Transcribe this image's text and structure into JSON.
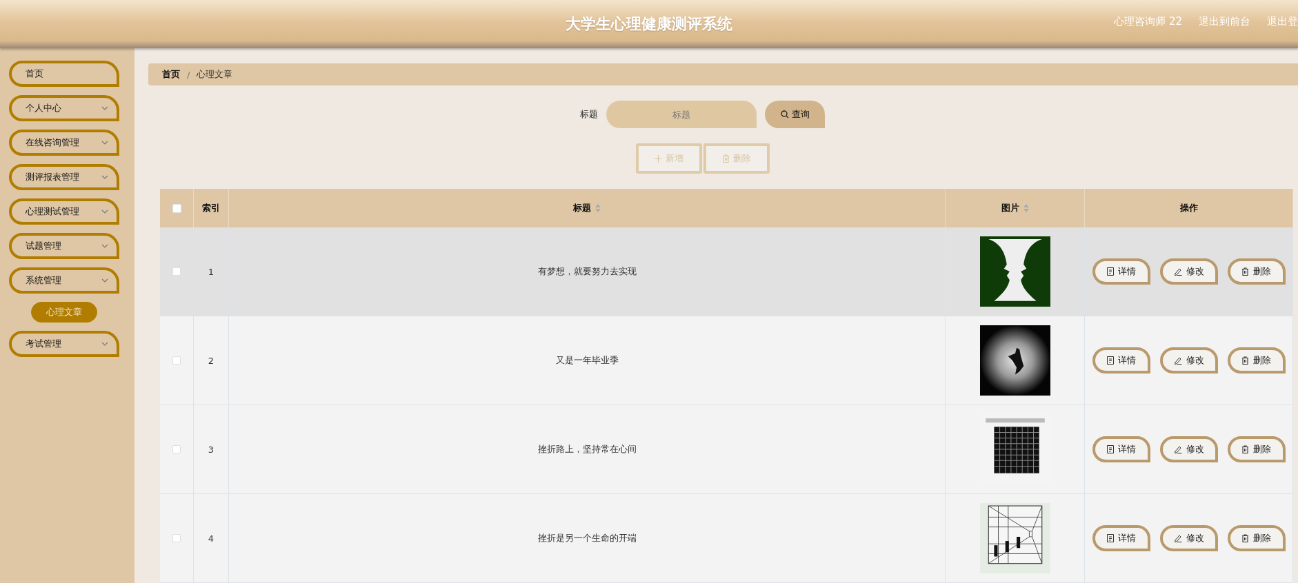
{
  "header": {
    "title": "大学生心理健康测评系统",
    "user": "心理咨询师 22",
    "links": [
      "退出到前台",
      "退出登"
    ]
  },
  "sidebar": {
    "items": [
      {
        "label": "首页",
        "kind": "link"
      },
      {
        "label": "个人中心",
        "kind": "menu"
      },
      {
        "label": "在线咨询管理",
        "kind": "menu"
      },
      {
        "label": "测评报表管理",
        "kind": "menu"
      },
      {
        "label": "心理测试管理",
        "kind": "menu"
      },
      {
        "label": "试题管理",
        "kind": "menu"
      },
      {
        "label": "系统管理",
        "kind": "menu",
        "children": [
          {
            "label": "心理文章",
            "selected": true
          }
        ]
      },
      {
        "label": "考试管理",
        "kind": "menu"
      }
    ]
  },
  "breadcrumb": {
    "separator": "/",
    "items": [
      "首页",
      "心理文章"
    ]
  },
  "search": {
    "label": "标题",
    "placeholder": "标题",
    "button": "查询"
  },
  "actions": [
    {
      "label": "新增",
      "kind": "add",
      "disabled": true
    },
    {
      "label": "删除",
      "kind": "delete",
      "disabled": true
    }
  ],
  "table": {
    "all_checked": false,
    "columns": [
      {
        "label": "索引",
        "sortable": false
      },
      {
        "label": "标题",
        "sortable": true
      },
      {
        "label": "图片",
        "sortable": true
      },
      {
        "label": "操作",
        "sortable": false
      }
    ],
    "rows": [
      {
        "checked": false,
        "highlighted": true,
        "index": "1",
        "title": "有梦想，就要努力去实现",
        "picture": {
          "kind": "picture"
        },
        "actions": [
          {
            "kind": "detail",
            "label": "详情"
          },
          {
            "kind": "edit",
            "label": "修改"
          },
          {
            "kind": "delete",
            "label": "删除"
          }
        ]
      },
      {
        "checked": false,
        "highlighted": false,
        "index": "2",
        "title": "又是一年毕业季",
        "picture": {
          "kind": "picture"
        },
        "actions": [
          {
            "kind": "detail",
            "label": "详情"
          },
          {
            "kind": "edit",
            "label": "修改"
          },
          {
            "kind": "delete",
            "label": "删除"
          }
        ]
      },
      {
        "checked": false,
        "highlighted": false,
        "index": "3",
        "title": "挫折路上，坚持常在心间",
        "picture": {
          "kind": "picture"
        },
        "actions": [
          {
            "kind": "detail",
            "label": "详情"
          },
          {
            "kind": "edit",
            "label": "修改"
          },
          {
            "kind": "delete",
            "label": "删除"
          }
        ]
      },
      {
        "checked": false,
        "highlighted": false,
        "index": "4",
        "title": "挫折是另一个生命的开端",
        "picture": {
          "kind": "picture"
        },
        "actions": [
          {
            "kind": "detail",
            "label": "详情"
          },
          {
            "kind": "edit",
            "label": "修改"
          },
          {
            "kind": "delete",
            "label": "删除"
          }
        ]
      }
    ]
  }
}
